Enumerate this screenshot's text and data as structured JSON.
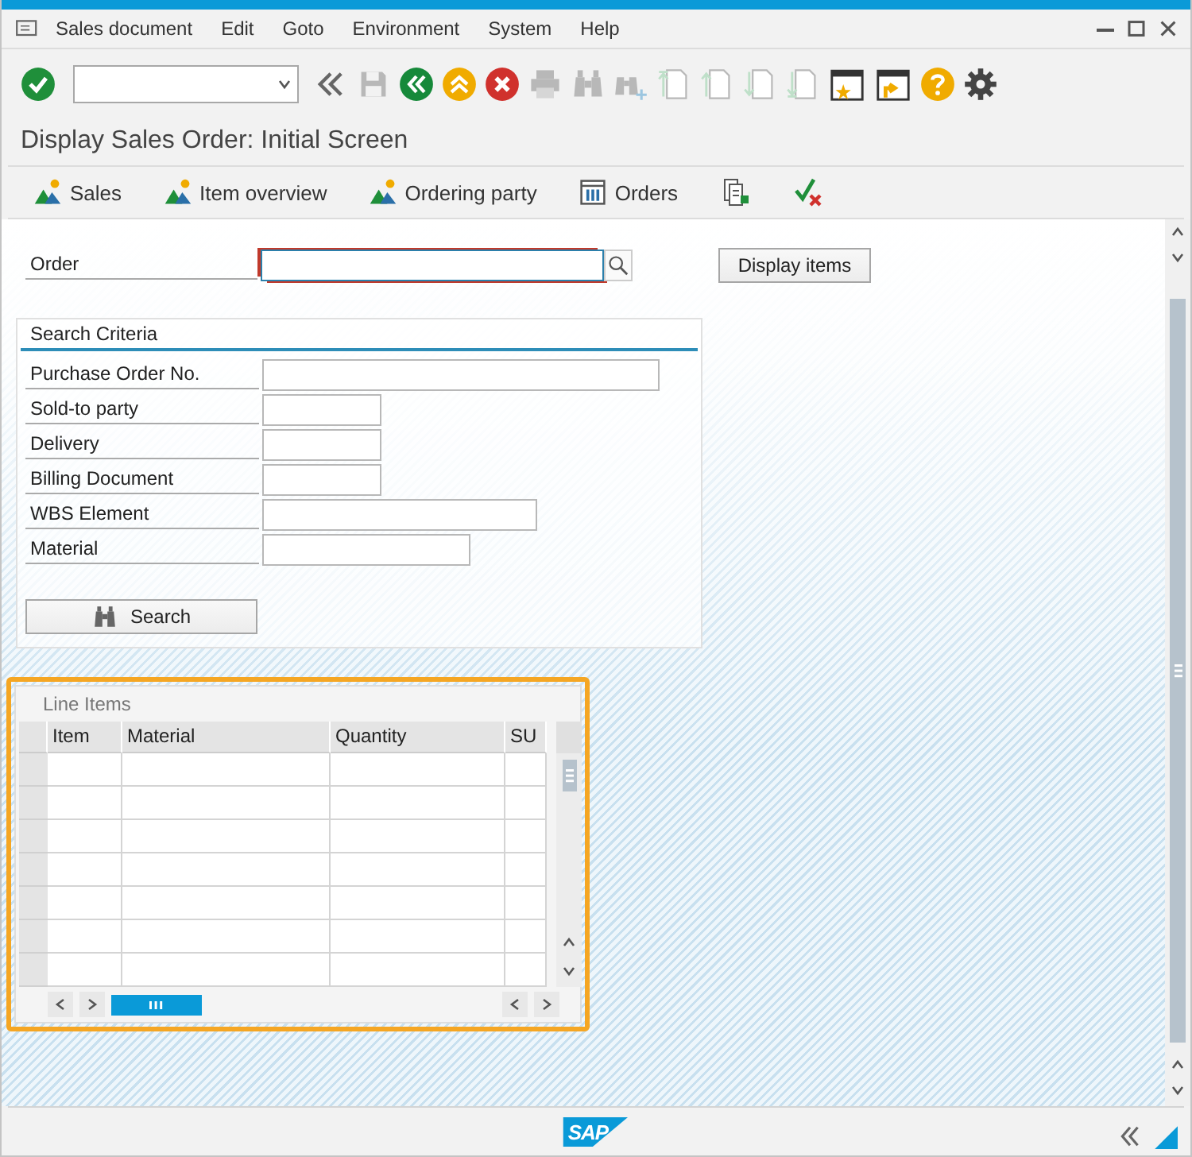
{
  "menu": [
    {
      "label": "Sales document"
    },
    {
      "label": "Edit"
    },
    {
      "label": "Goto"
    },
    {
      "label": "Environment"
    },
    {
      "label": "System"
    },
    {
      "label": "Help"
    }
  ],
  "toolbar": [
    {
      "kind": "enter",
      "disabled": false
    },
    {
      "kind": "command"
    },
    {
      "kind": "collapse",
      "disabled": false
    },
    {
      "kind": "save",
      "disabled": true
    },
    {
      "kind": "back",
      "disabled": false
    },
    {
      "kind": "exit",
      "disabled": false
    },
    {
      "kind": "cancel",
      "disabled": false
    },
    {
      "kind": "print",
      "disabled": true
    },
    {
      "kind": "find",
      "disabled": true
    },
    {
      "kind": "find-next",
      "disabled": true
    },
    {
      "kind": "first-page",
      "disabled": true
    },
    {
      "kind": "prev-page",
      "disabled": true
    },
    {
      "kind": "next-page",
      "disabled": true
    },
    {
      "kind": "last-page",
      "disabled": true
    },
    {
      "kind": "new-session",
      "disabled": false
    },
    {
      "kind": "shortcut",
      "disabled": false
    },
    {
      "kind": "help",
      "disabled": false
    },
    {
      "kind": "settings",
      "disabled": false
    }
  ],
  "title": "Display Sales Order: Initial Screen",
  "app_toolbar": [
    {
      "kind": "mountain",
      "label": "Sales"
    },
    {
      "kind": "mountain",
      "label": "Item overview"
    },
    {
      "kind": "mountain",
      "label": "Ordering party"
    },
    {
      "kind": "table",
      "label": "Orders"
    },
    {
      "kind": "document"
    },
    {
      "kind": "check-cross"
    }
  ],
  "order": {
    "label": "Order",
    "focused": true,
    "button": "Display items"
  },
  "search_criteria": {
    "title": "Search Criteria",
    "fields": [
      {
        "label": "Purchase Order No."
      },
      {
        "label": "Sold-to party"
      },
      {
        "label": "Delivery"
      },
      {
        "label": "Billing Document"
      },
      {
        "label": "WBS Element"
      },
      {
        "label": "Material"
      }
    ],
    "button": "Search"
  },
  "line_items": {
    "title": "Line Items",
    "highlighted": true,
    "columns": [
      "Item",
      "Material",
      "Quantity",
      "SU"
    ]
  },
  "footer": {
    "logo": "SAP"
  }
}
